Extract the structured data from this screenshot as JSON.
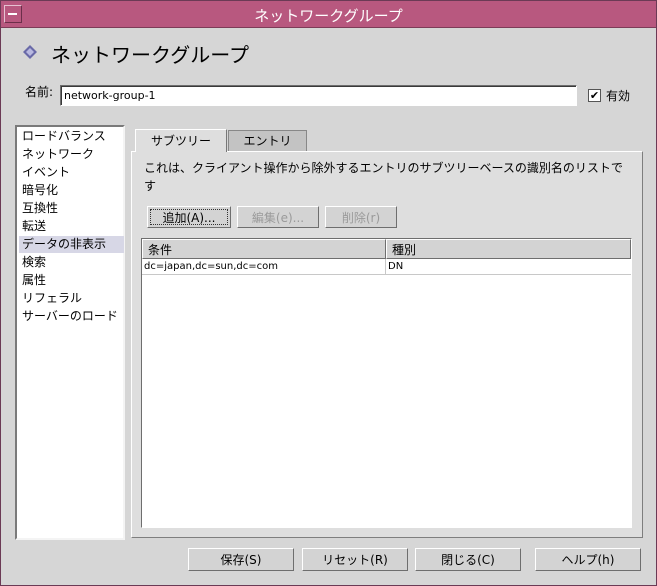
{
  "window": {
    "title": "ネットワークグループ"
  },
  "header": {
    "title": "ネットワークグループ",
    "icon": "diamond-icon"
  },
  "name_field": {
    "label": "名前:",
    "value": "network-group-1"
  },
  "enabled": {
    "label": "有効",
    "checked": true
  },
  "sidebar": {
    "items": [
      {
        "label": "ロードバランス"
      },
      {
        "label": "ネットワーク"
      },
      {
        "label": "イベント"
      },
      {
        "label": "暗号化"
      },
      {
        "label": "互換性"
      },
      {
        "label": "転送"
      },
      {
        "label": "データの非表示",
        "selected": true
      },
      {
        "label": "検索"
      },
      {
        "label": "属性"
      },
      {
        "label": "リフェラル"
      },
      {
        "label": "サーバーのロード"
      }
    ]
  },
  "tabs": [
    {
      "label": "サブツリー",
      "active": true
    },
    {
      "label": "エントリ",
      "active": false
    }
  ],
  "panel": {
    "description": "これは、クライアント操作から除外するエントリのサブツリーベースの識別名のリストです",
    "buttons": {
      "add": "追加(A)...",
      "edit": "編集(e)...",
      "delete": "削除(r)"
    },
    "table": {
      "columns": [
        "条件",
        "種別"
      ],
      "rows": [
        [
          "dc=japan,dc=sun,dc=com",
          "DN"
        ]
      ]
    }
  },
  "footer": {
    "save": "保存(S)",
    "reset": "リセット(R)",
    "close": "閉じる(C)",
    "help": "ヘルプ(h)"
  },
  "colors": {
    "titlebar": "#b8587f",
    "selection": "#d7d7e6",
    "background": "#d6d6d6"
  }
}
